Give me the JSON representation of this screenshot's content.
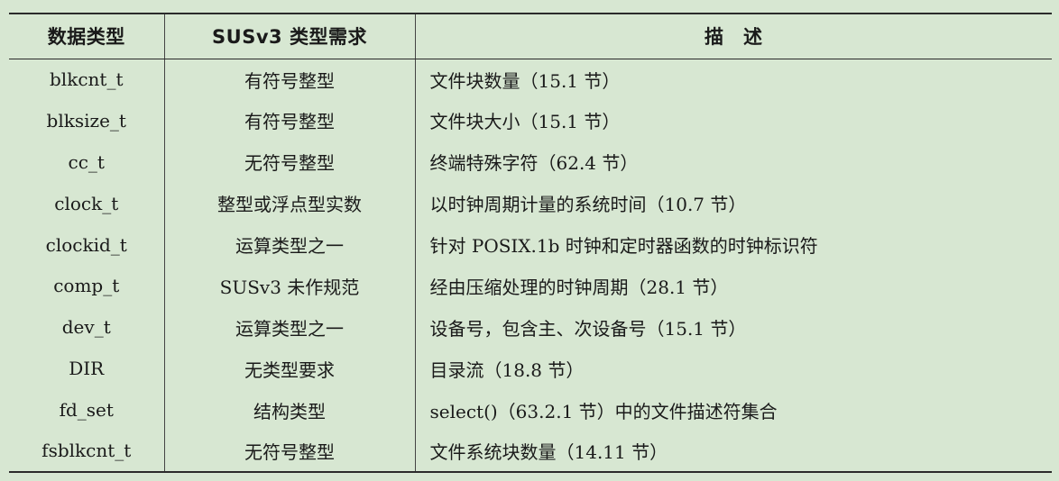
{
  "table": {
    "headers": {
      "type": "数据类型",
      "requirement": "SUSv3 类型需求",
      "description": "描　述"
    },
    "rows": [
      {
        "type": "blkcnt_t",
        "requirement": "有符号整型",
        "description": "文件块数量（15.1 节）"
      },
      {
        "type": "blksize_t",
        "requirement": "有符号整型",
        "description": "文件块大小（15.1 节）"
      },
      {
        "type": "cc_t",
        "requirement": "无符号整型",
        "description": "终端特殊字符（62.4 节）"
      },
      {
        "type": "clock_t",
        "requirement": "整型或浮点型实数",
        "description": "以时钟周期计量的系统时间（10.7 节）"
      },
      {
        "type": "clockid_t",
        "requirement": "运算类型之一",
        "description": "针对 POSIX.1b 时钟和定时器函数的时钟标识符"
      },
      {
        "type": "comp_t",
        "requirement": "SUSv3 未作规范",
        "description": "经由压缩处理的时钟周期（28.1 节）"
      },
      {
        "type": "dev_t",
        "requirement": "运算类型之一",
        "description": "设备号，包含主、次设备号（15.1 节）"
      },
      {
        "type": "DIR",
        "requirement": "无类型要求",
        "description": "目录流（18.8 节）"
      },
      {
        "type": "fd_set",
        "requirement": "结构类型",
        "description": "select()（63.2.1 节）中的文件描述符集合"
      },
      {
        "type": "fsblkcnt_t",
        "requirement": "无符号整型",
        "description": "文件系统块数量（14.11 节）"
      }
    ]
  }
}
